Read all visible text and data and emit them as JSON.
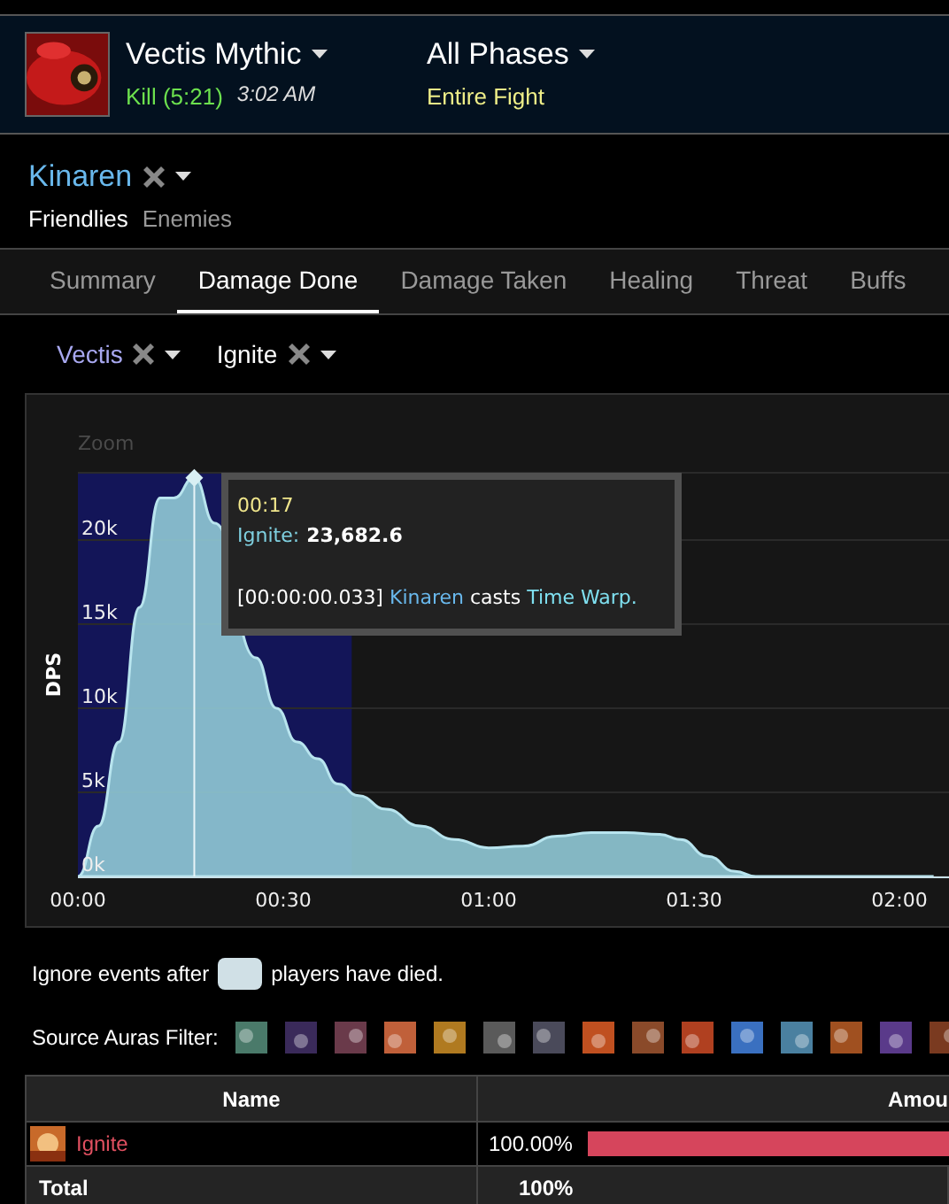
{
  "header": {
    "boss": "Vectis Mythic",
    "result": "Kill (5:21)",
    "time": "3:02 AM",
    "phase": "All Phases",
    "phase_sub": "Entire Fight"
  },
  "player": {
    "name": "Kinaren",
    "filters": [
      {
        "label": "Friendlies",
        "selected": true
      },
      {
        "label": "Enemies",
        "selected": false
      }
    ]
  },
  "tabs": [
    {
      "label": "Summary",
      "selected": false
    },
    {
      "label": "Damage Done",
      "selected": true
    },
    {
      "label": "Damage Taken",
      "selected": false
    },
    {
      "label": "Healing",
      "selected": false
    },
    {
      "label": "Threat",
      "selected": false
    },
    {
      "label": "Buffs",
      "selected": false
    }
  ],
  "target_filters": [
    {
      "label": "Vectis",
      "kind": "target"
    },
    {
      "label": "Ignite",
      "kind": "ability"
    }
  ],
  "chart": {
    "zoom_label": "Zoom",
    "chart_data": {
      "type": "area",
      "ylabel": "DPS",
      "ylim": [
        0,
        24000
      ],
      "xlim": [
        0,
        127.5
      ],
      "grid": true,
      "ref_lines": [
        {
          "axis": "x",
          "value": 17
        }
      ],
      "x": [
        0,
        3,
        6,
        9,
        12,
        14,
        17,
        20,
        26,
        29,
        32,
        35,
        38,
        41,
        45,
        50,
        55,
        60,
        65,
        70,
        75,
        80,
        85,
        88,
        92,
        96,
        99,
        125
      ],
      "series": [
        {
          "name": "Ignite",
          "color": "#8ec5d2",
          "values": [
            0,
            3000,
            8000,
            16000,
            22500,
            22500,
            23700,
            21000,
            13000,
            10000,
            8000,
            7000,
            5500,
            4800,
            4000,
            3000,
            2200,
            1700,
            1800,
            2400,
            2600,
            2600,
            2500,
            2200,
            1200,
            300,
            0,
            0
          ]
        }
      ],
      "xticks": [
        {
          "value": 0,
          "label": "00:00"
        },
        {
          "value": 30,
          "label": "00:30"
        },
        {
          "value": 60,
          "label": "01:00"
        },
        {
          "value": 90,
          "label": "01:30"
        },
        {
          "value": 120,
          "label": "02:00"
        }
      ],
      "yticks": [
        {
          "value": 0,
          "label": "0k"
        },
        {
          "value": 5000,
          "label": "5k"
        },
        {
          "value": 10000,
          "label": "10k"
        },
        {
          "value": 15000,
          "label": "15k"
        },
        {
          "value": 20000,
          "label": "20k"
        }
      ]
    },
    "tooltip": {
      "time": "00:17",
      "sep": ":",
      "value": "23,682.6",
      "event": {
        "timestamp": "[00:00:00.033]",
        "actor": "Kinaren",
        "verb": "casts",
        "spell": "Time Warp."
      }
    }
  },
  "ignore_events": {
    "before": "Ignore events after",
    "after": "players have died."
  },
  "auras": {
    "label": "Source Auras Filter:",
    "items": [
      {
        "color": "#4a7a6a"
      },
      {
        "color": "#3a2a5a"
      },
      {
        "color": "#6a3a4a"
      },
      {
        "color": "#c0603a"
      },
      {
        "color": "#b07a20"
      },
      {
        "color": "#5a5a5a"
      },
      {
        "color": "#4a4a5a"
      },
      {
        "color": "#c05020"
      },
      {
        "color": "#8a4a2a"
      },
      {
        "color": "#b04020"
      },
      {
        "color": "#3a70c0"
      },
      {
        "color": "#4a80a0"
      },
      {
        "color": "#a05020"
      },
      {
        "color": "#5a3a8a"
      },
      {
        "color": "#7a3a20"
      }
    ]
  },
  "table": {
    "columns": [
      "Name",
      "Amou"
    ],
    "rows": [
      {
        "name": "Ignite",
        "percent": "100.00%",
        "level": 1
      }
    ],
    "total": {
      "label": "Total",
      "value": "100%"
    }
  }
}
